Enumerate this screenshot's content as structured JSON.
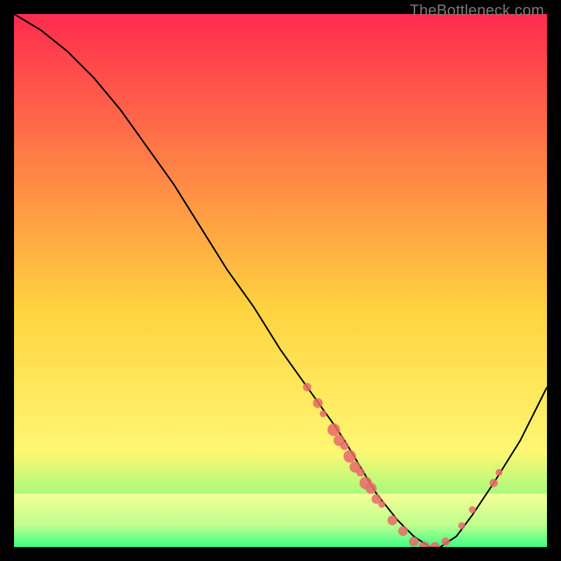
{
  "watermark": "TheBottleneck.com",
  "chart_data": {
    "type": "line",
    "title": "",
    "xlabel": "",
    "ylabel": "",
    "xlim": [
      0,
      100
    ],
    "ylim": [
      0,
      100
    ],
    "background_gradient": {
      "top": "#ff2b4e",
      "mid1": "#ffd23f",
      "mid2": "#fff772",
      "bottom": "#3cff87"
    },
    "highlight_band": {
      "from_y": 0,
      "to_y": 10,
      "color_top": "#feff9a",
      "color_bottom": "#3cff87"
    },
    "series": [
      {
        "name": "bottleneck-curve",
        "x": [
          0,
          5,
          10,
          15,
          20,
          25,
          30,
          35,
          40,
          45,
          50,
          55,
          60,
          62,
          65,
          68,
          72,
          75,
          78,
          80,
          83,
          86,
          90,
          95,
          100
        ],
        "y": [
          100,
          97,
          93,
          88,
          82,
          75,
          68,
          60,
          52,
          45,
          37,
          30,
          23,
          20,
          15,
          10,
          5,
          2,
          0,
          0,
          2,
          6,
          12,
          20,
          30
        ]
      }
    ],
    "markers": {
      "name": "highlighted-points",
      "color": "#e86a6a",
      "points": [
        {
          "x": 55,
          "y": 30,
          "r": 6
        },
        {
          "x": 57,
          "y": 27,
          "r": 7
        },
        {
          "x": 58,
          "y": 25,
          "r": 5
        },
        {
          "x": 60,
          "y": 22,
          "r": 9
        },
        {
          "x": 61,
          "y": 20,
          "r": 8
        },
        {
          "x": 62,
          "y": 19,
          "r": 6
        },
        {
          "x": 63,
          "y": 17,
          "r": 9
        },
        {
          "x": 64,
          "y": 15,
          "r": 8
        },
        {
          "x": 65,
          "y": 14,
          "r": 6
        },
        {
          "x": 66,
          "y": 12,
          "r": 9
        },
        {
          "x": 67,
          "y": 11,
          "r": 8
        },
        {
          "x": 68,
          "y": 9,
          "r": 7
        },
        {
          "x": 69,
          "y": 8,
          "r": 5
        },
        {
          "x": 71,
          "y": 5,
          "r": 7
        },
        {
          "x": 73,
          "y": 3,
          "r": 7
        },
        {
          "x": 75,
          "y": 1,
          "r": 7
        },
        {
          "x": 77,
          "y": 0,
          "r": 8
        },
        {
          "x": 79,
          "y": 0,
          "r": 7
        },
        {
          "x": 81,
          "y": 1,
          "r": 6
        },
        {
          "x": 84,
          "y": 4,
          "r": 5
        },
        {
          "x": 86,
          "y": 7,
          "r": 5
        },
        {
          "x": 90,
          "y": 12,
          "r": 6
        },
        {
          "x": 91,
          "y": 14,
          "r": 5
        }
      ]
    }
  }
}
